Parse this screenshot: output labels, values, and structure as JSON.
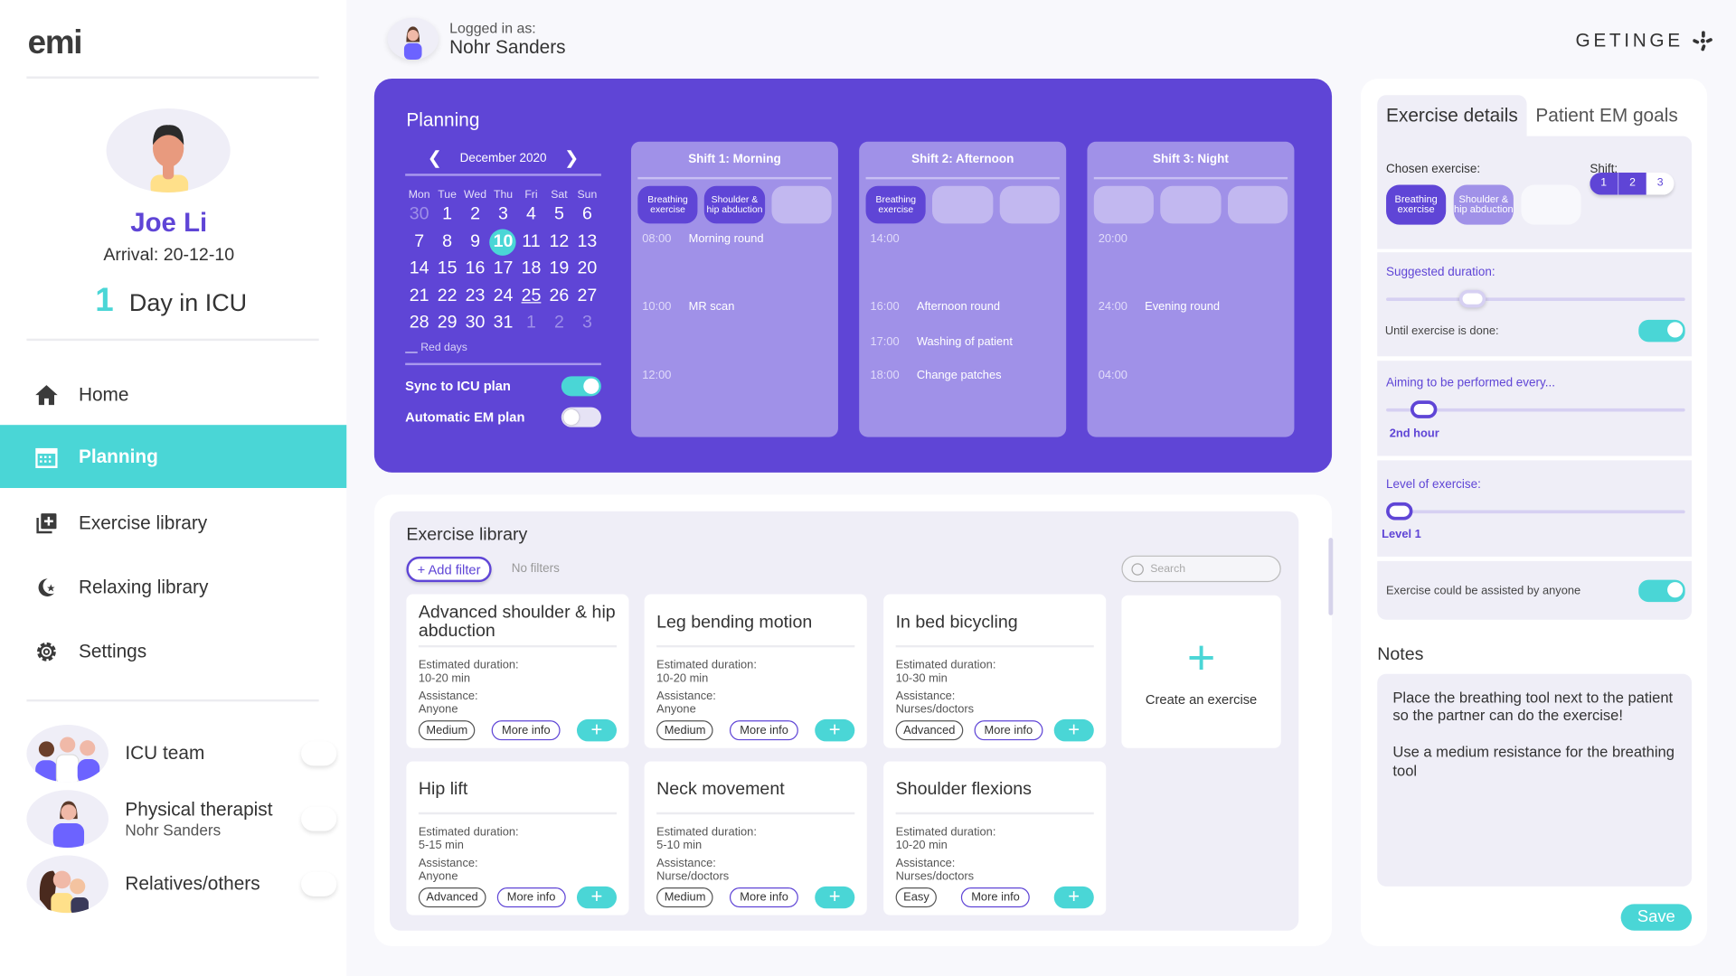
{
  "colors": {
    "primary": "#5f45d6",
    "accent": "#4ad6d6",
    "shift_bg": "#a091e8"
  },
  "sidebar": {
    "logo": "emi",
    "patient": {
      "name": "Joe Li",
      "arrival": "Arrival: 20-12-10",
      "days": "1",
      "days_label": "Day in ICU"
    },
    "nav": [
      {
        "label": "Home",
        "icon": "home-icon"
      },
      {
        "label": "Planning",
        "icon": "calendar-icon",
        "active": true
      },
      {
        "label": "Exercise library",
        "icon": "library-add-icon"
      },
      {
        "label": "Relaxing library",
        "icon": "moon-star-icon"
      },
      {
        "label": "Settings",
        "icon": "gear-icon"
      }
    ],
    "team": [
      {
        "label": "ICU team",
        "sub": ""
      },
      {
        "label": "Physical therapist",
        "sub": "Nohr Sanders"
      },
      {
        "label": "Relatives/others",
        "sub": ""
      }
    ]
  },
  "header": {
    "logged_label": "Logged in as:",
    "user": "Nohr Sanders",
    "brand": "GETINGE"
  },
  "planning": {
    "title": "Planning",
    "calendar": {
      "month": "December 2020",
      "dow": [
        "Mon",
        "Tue",
        "Wed",
        "Thu",
        "Fri",
        "Sat",
        "Sun"
      ],
      "weeks": [
        [
          "30",
          "1",
          "2",
          "3",
          "4",
          "5",
          "6"
        ],
        [
          "7",
          "8",
          "9",
          "10",
          "11",
          "12",
          "13"
        ],
        [
          "14",
          "15",
          "16",
          "17",
          "18",
          "19",
          "20"
        ],
        [
          "21",
          "22",
          "23",
          "24",
          "25",
          "26",
          "27"
        ],
        [
          "28",
          "29",
          "30",
          "31",
          "1",
          "2",
          "3"
        ]
      ],
      "today": "10",
      "red_day": "25",
      "legend": "Red days"
    },
    "sync_label": "Sync to ICU plan",
    "sync_on": true,
    "auto_label": "Automatic EM plan",
    "auto_on": false,
    "shifts": [
      {
        "title": "Shift 1: Morning",
        "slots": [
          "Breathing exercise",
          "Shoulder & hip abduction",
          ""
        ],
        "events": [
          {
            "time": "08:00",
            "text": "Morning round"
          },
          {
            "time": "10:00",
            "text": "MR scan"
          },
          {
            "time": "12:00",
            "text": ""
          }
        ]
      },
      {
        "title": "Shift 2: Afternoon",
        "slots": [
          "Breathing exercise",
          "",
          ""
        ],
        "events": [
          {
            "time": "14:00",
            "text": ""
          },
          {
            "time": "16:00",
            "text": "Afternoon round"
          },
          {
            "time": "17:00",
            "text": "Washing of patient"
          },
          {
            "time": "18:00",
            "text": "Change patches"
          }
        ]
      },
      {
        "title": "Shift 3: Night",
        "slots": [
          "",
          "",
          ""
        ],
        "events": [
          {
            "time": "20:00",
            "text": ""
          },
          {
            "time": "24:00",
            "text": "Evening round"
          },
          {
            "time": "04:00",
            "text": ""
          }
        ]
      }
    ]
  },
  "library": {
    "title": "Exercise library",
    "add_filter": "+ Add filter",
    "no_filters": "No filters",
    "search_placeholder": "Search",
    "dur_label": "Estimated duration:",
    "assist_label": "Assistance:",
    "more_info": "More info",
    "cards": [
      {
        "title": "Advanced shoulder & hip abduction",
        "duration": "10-20 min",
        "assistance": "Anyone",
        "level": "Medium"
      },
      {
        "title": "Leg bending motion",
        "duration": "10-20 min",
        "assistance": "Anyone",
        "level": "Medium"
      },
      {
        "title": "In bed bicycling",
        "duration": "10-30 min",
        "assistance": "Nurses/doctors",
        "level": "Advanced"
      },
      {
        "title": "Hip lift",
        "duration": "5-15 min",
        "assistance": "Anyone",
        "level": "Advanced"
      },
      {
        "title": "Neck movement",
        "duration": "5-10 min",
        "assistance": "Nurse/doctors",
        "level": "Medium"
      },
      {
        "title": "Shoulder flexions",
        "duration": "10-20 min",
        "assistance": "Nurses/doctors",
        "level": "Easy"
      }
    ],
    "create_label": "Create an exercise"
  },
  "details": {
    "tabs": [
      "Exercise details",
      "Patient EM goals"
    ],
    "chosen_label": "Chosen exercise:",
    "chosen": [
      "Breathing exercise",
      "Shoulder & hip abduction",
      ""
    ],
    "shift_label": "Shift:",
    "shift_options": [
      "1",
      "2",
      "3"
    ],
    "shift_selected": [
      "1",
      "2"
    ],
    "suggested_label": "Suggested duration:",
    "suggested_fraction": 0.27,
    "until_label": "Until exercise is done:",
    "until_on": true,
    "aiming_label": "Aiming to be performed every...",
    "aiming_value": "2nd hour",
    "aiming_fraction": 0.09,
    "level_label": "Level of exercise:",
    "level_value": "Level 1",
    "level_fraction": 0.0,
    "assist_label": "Exercise could be assisted by anyone",
    "assist_on": true,
    "notes_label": "Notes",
    "notes": [
      "Place the breathing tool next to the patient so the partner can do the exercise!",
      "Use a medium resistance for the breathing tool"
    ],
    "save": "Save"
  }
}
